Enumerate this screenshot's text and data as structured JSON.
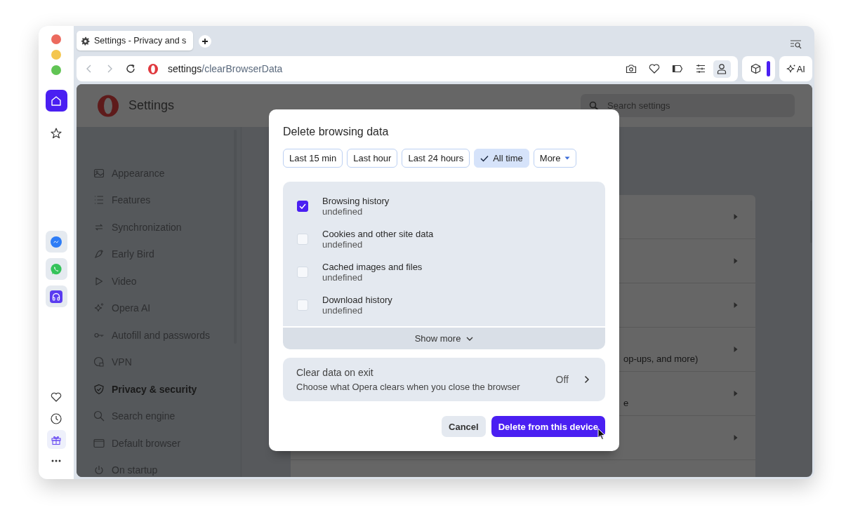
{
  "tab": {
    "title": "Settings - Privacy and s"
  },
  "address_bar": {
    "host": "settings",
    "path": "/clearBrowserData"
  },
  "toolbar": {
    "ai_label": "AI"
  },
  "settings": {
    "title": "Settings",
    "search": {
      "placeholder": "Search settings"
    },
    "nav": [
      {
        "label": "Appearance",
        "selected": false
      },
      {
        "label": "Features",
        "selected": false
      },
      {
        "label": "Synchronization",
        "selected": false
      },
      {
        "label": "Early Bird",
        "selected": false
      },
      {
        "label": "Video",
        "selected": false
      },
      {
        "label": "Opera AI",
        "selected": false
      },
      {
        "label": "Autofill and passwords",
        "selected": false
      },
      {
        "label": "VPN",
        "selected": false
      },
      {
        "label": "Privacy & security",
        "selected": true
      },
      {
        "label": "Search engine",
        "selected": false
      },
      {
        "label": "Default browser",
        "selected": false
      },
      {
        "label": "On startup",
        "selected": false
      }
    ],
    "cards": [
      {
        "kind": "plain"
      },
      {
        "kind": "plain"
      },
      {
        "kind": "plain"
      },
      {
        "kind": "described",
        "description": "op-ups, and more)"
      },
      {
        "kind": "described",
        "description": "e"
      },
      {
        "kind": "plain"
      }
    ]
  },
  "dialog": {
    "title": "Delete browsing data",
    "ranges": [
      {
        "label": "Last 15 min",
        "kind": "chip",
        "selected": false
      },
      {
        "label": "Last hour",
        "kind": "chip",
        "selected": false
      },
      {
        "label": "Last 24 hours",
        "kind": "chip",
        "selected": false
      },
      {
        "label": "All time",
        "kind": "chip",
        "selected": true
      },
      {
        "label": "More",
        "kind": "dropdown",
        "selected": false
      }
    ],
    "items": [
      {
        "label": "Browsing history",
        "detail": "undefined",
        "checked": true
      },
      {
        "label": "Cookies and other site data",
        "detail": "undefined",
        "checked": false
      },
      {
        "label": "Cached images and files",
        "detail": "undefined",
        "checked": false
      },
      {
        "label": "Download history",
        "detail": "undefined",
        "checked": false
      }
    ],
    "show_more": "Show more",
    "exit_setting": {
      "title": "Clear data on exit",
      "description": "Choose what Opera clears when you close the browser",
      "value": "Off"
    },
    "buttons": [
      {
        "label": "Cancel",
        "kind": "secondary"
      },
      {
        "label": "Delete from this device",
        "kind": "primary"
      }
    ]
  }
}
